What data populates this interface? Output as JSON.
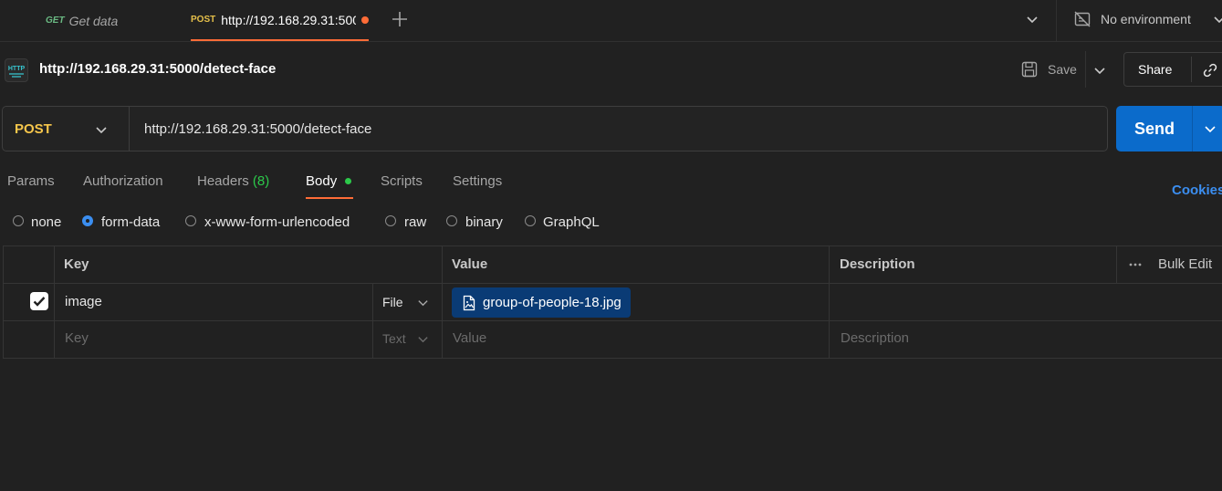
{
  "tabs": [
    {
      "method": "GET",
      "label": "Get data"
    },
    {
      "method": "POST",
      "label": "http://192.168.29.31:5000/detect-face",
      "unsaved": true
    }
  ],
  "environment": {
    "label": "No environment"
  },
  "request": {
    "icon_text": "HTTP",
    "title": "http://192.168.29.31:5000/detect-face",
    "save_label": "Save",
    "share_label": "Share",
    "method": "POST",
    "url": "http://192.168.29.31:5000/detect-face",
    "send_label": "Send"
  },
  "subtabs": {
    "params": "Params",
    "authorization": "Authorization",
    "headers": "Headers",
    "headers_count": "(8)",
    "body": "Body",
    "scripts": "Scripts",
    "settings": "Settings",
    "cookies": "Cookies"
  },
  "body_types": {
    "selected": "form-data",
    "options": [
      "none",
      "form-data",
      "x-www-form-urlencoded",
      "raw",
      "binary",
      "GraphQL"
    ]
  },
  "table": {
    "headers": {
      "key": "Key",
      "value": "Value",
      "description": "Description",
      "bulk_edit": "Bulk Edit"
    },
    "rows": [
      {
        "checked": true,
        "key": "image",
        "type": "File",
        "value": "group-of-people-18.jpg",
        "description": ""
      }
    ],
    "placeholder": {
      "key": "Key",
      "type": "Text",
      "value": "Value",
      "description": "Description"
    }
  },
  "colors": {
    "background": "#212121",
    "accent": "#ff6c37",
    "send": "#0b6bcb",
    "post_method": "#f6c64b",
    "get_method": "#6bbb84",
    "link": "#3b8ef0",
    "file_chip": "#0a3b75"
  },
  "icons": [
    "plus-icon",
    "chevron-down-icon",
    "no-environment-icon",
    "http-icon",
    "save-icon",
    "link-icon",
    "file-image-icon",
    "more-horizontal-icon",
    "checkmark-icon"
  ]
}
